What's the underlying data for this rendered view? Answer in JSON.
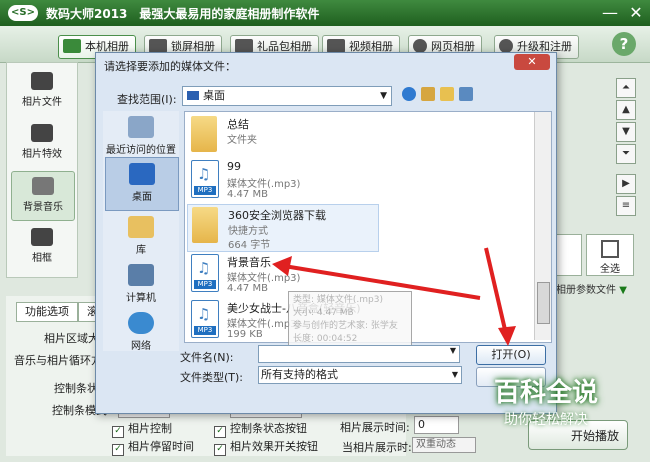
{
  "app": {
    "logo_text": "<S>",
    "title": "数码大师2013　最强大最易用的家庭相册制作软件"
  },
  "window_controls": {
    "minimize": "—",
    "close": "✕"
  },
  "toolbar": {
    "tabs": [
      {
        "label": "本机相册",
        "active": true
      },
      {
        "label": "锁屏相册"
      },
      {
        "label": "礼品包相册"
      },
      {
        "label": "视频相册"
      },
      {
        "label": "网页相册"
      },
      {
        "label": "升级和注册"
      }
    ],
    "help": "?"
  },
  "sidebar": {
    "items": [
      {
        "label": "相片文件"
      },
      {
        "label": "相片特效"
      },
      {
        "label": "背景音乐",
        "active": true
      },
      {
        "label": "相框"
      }
    ]
  },
  "right_tools": {
    "select_all": "全选",
    "param_label": "相册参数文件"
  },
  "lower_panel": {
    "tabs": [
      "功能选项",
      "滚"
    ],
    "labels": {
      "photo_area": "相片区域大",
      "music_loop": "音乐与相片循环方",
      "control_bar": "控制条状",
      "control_mode": "控制条模式"
    },
    "checkboxes": [
      {
        "label": "相片控制",
        "checked": true
      },
      {
        "label": "控制条状态按钮",
        "checked": true
      },
      {
        "label": "相片停留时间",
        "checked": true
      },
      {
        "label": "相片效果开关按钮",
        "checked": true
      }
    ],
    "digital_display": "数字显",
    "show_time_label": "相片展示时间:",
    "show_time_value": "0",
    "show_time_label2": "当相片展示时:",
    "dual_anim": "双重动态",
    "start_button": "开始播放"
  },
  "dialog": {
    "title": "请选择要添加的媒体文件：",
    "close": "✕",
    "look_in_label": "查找范围(I):",
    "look_in_value": "桌面",
    "places": [
      {
        "label": "最近访问的位置"
      },
      {
        "label": "桌面",
        "active": true
      },
      {
        "label": "库"
      },
      {
        "label": "计算机"
      },
      {
        "label": "网络"
      }
    ],
    "files": [
      {
        "name": "总结",
        "type": "文件夹",
        "size": ""
      },
      {
        "name": "99",
        "type": "媒体文件(.mp3)",
        "size": "4.47 MB"
      },
      {
        "name": "360安全浏览器下载",
        "type": "快捷方式",
        "size": "664 字节"
      },
      {
        "name": "背景音乐",
        "type": "媒体文件(.mp3)",
        "size": "4.47 MB"
      },
      {
        "name": "美少女战士-八音盒(轻音乐)",
        "type": "媒体文件(.mp3)",
        "size": "199 KB"
      }
    ],
    "badge": "MP3",
    "tooltip": {
      "line1": "类型: 媒体文件(.mp3)",
      "line2": "大小: 4.47 MB",
      "line3": "参与创作的艺术家: 张学友",
      "line4": "长度: 00:04:52"
    },
    "filename_label": "文件名(N):",
    "filename_value": "",
    "filetype_label": "文件类型(T):",
    "filetype_value": "所有支持的格式",
    "open_button": "打开(O)"
  },
  "watermark": {
    "line1": "百科全说",
    "line2": "助你轻松解决"
  }
}
